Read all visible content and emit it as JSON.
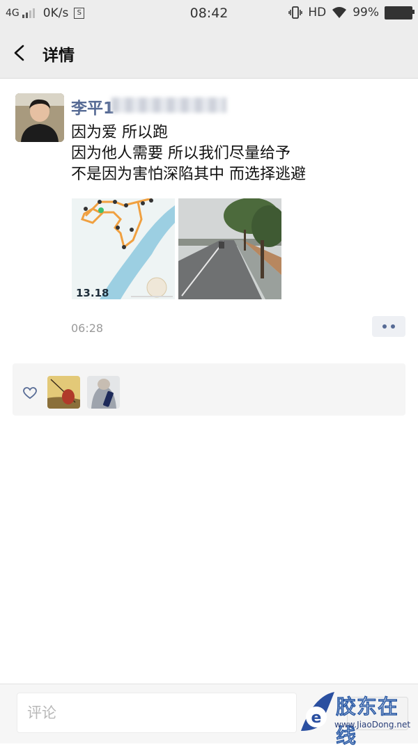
{
  "status_bar": {
    "network": "4G",
    "speed": "0K/s",
    "sim_badge": "S",
    "time": "08:42",
    "hd": "HD",
    "battery": "99%",
    "battery_level": 0.99,
    "icons": [
      "signal-icon",
      "vibrate-icon",
      "wifi-icon",
      "battery-icon"
    ]
  },
  "nav": {
    "back_icon": "chevron-left-icon",
    "title": "详情"
  },
  "post": {
    "username": "李平1",
    "text": "因为爱 所以跑\n因为他人需要 所以我们尽量给予\n不是因为害怕深陷其中 而选择逃避",
    "images": [
      {
        "icon": "running-route-map-image",
        "label": "13.18"
      },
      {
        "icon": "road-photo-image"
      }
    ],
    "time": "06:28",
    "more_icon": "more-dots-icon"
  },
  "likes": {
    "icon": "heart-icon",
    "avatars": [
      "like-avatar-1",
      "like-avatar-2"
    ]
  },
  "comment": {
    "placeholder": "评论"
  },
  "watermark": {
    "text": "胶东在线",
    "url": "www.JiaoDong.net"
  },
  "colors": {
    "link_blue": "#576b95",
    "header_bg": "#ededed",
    "route_orange": "#f0a040",
    "river_blue": "#8ec7e0"
  }
}
